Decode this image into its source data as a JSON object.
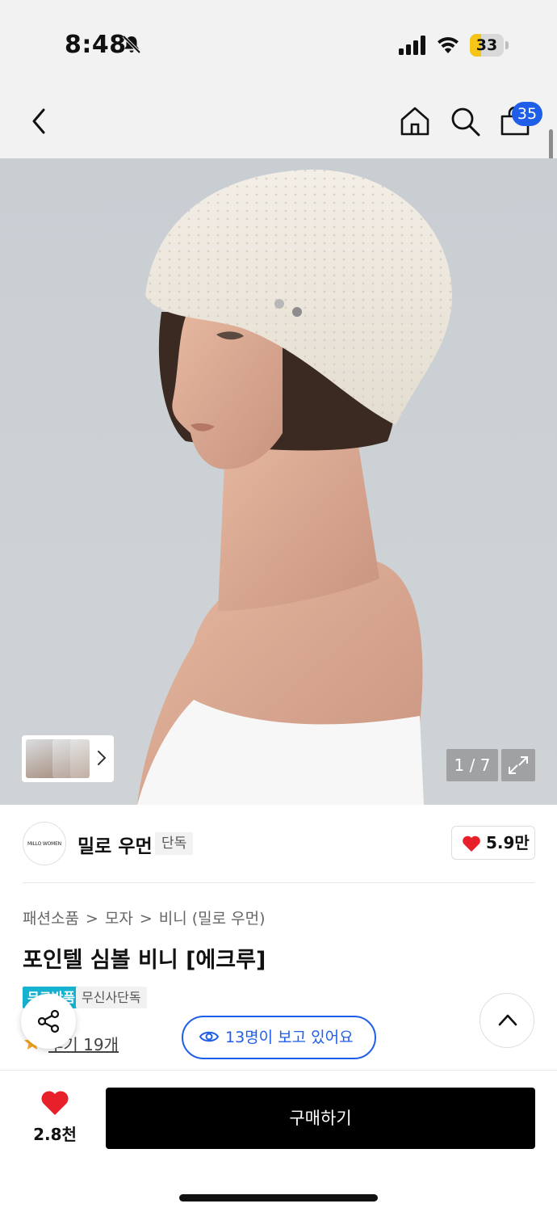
{
  "status_bar": {
    "time": "8:48",
    "battery": "33",
    "battery_level": 0.33,
    "icons": [
      "bell-slash-icon",
      "cellular-signal-icon",
      "wifi-icon",
      "battery-icon"
    ]
  },
  "header": {
    "icons": [
      "chevron-left-icon",
      "home-icon",
      "search-icon",
      "shopping-bag-icon"
    ],
    "cart_badge": "35"
  },
  "gallery": {
    "counter": "1 / 7",
    "current": 1,
    "total": 7,
    "icons": [
      "chevron-right-icon",
      "expand-icon"
    ]
  },
  "brand": {
    "logo_text": "MILLO WOMEN",
    "name": "밀로 우먼",
    "tag": "단독",
    "likes": "5.9만"
  },
  "product": {
    "breadcrumb": [
      "패션소품",
      "모자",
      "비니 (밀로 우먼)"
    ],
    "breadcrumb_separator": ">",
    "title": "포인텔 심볼 비니 [에크루]",
    "tags": [
      "무료반품",
      "무신사단독"
    ],
    "review_link": "후기 19개",
    "viewers": "13명이 보고 있어요"
  },
  "bottom_bar": {
    "wish_count": "2.8천",
    "buy_label": "구매하기"
  },
  "colors": {
    "accent_blue": "#1f5ee8",
    "heart_red": "#e8202a",
    "tag_cyan": "#15b3d1",
    "battery_yellow": "#f5c518"
  }
}
